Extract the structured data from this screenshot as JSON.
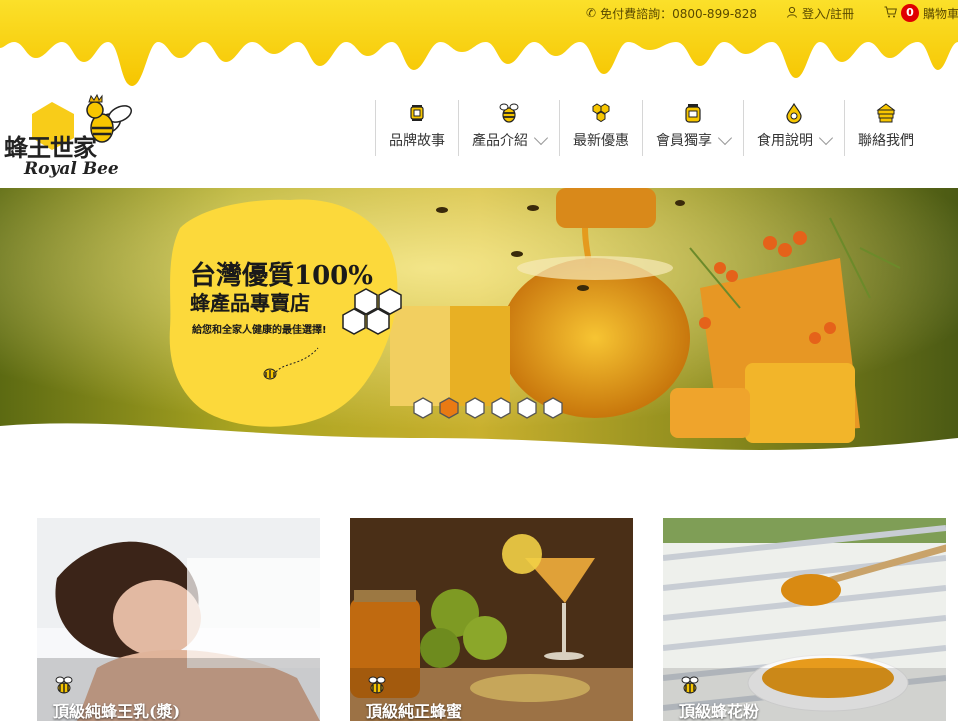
{
  "header": {
    "hotline": "免付費諮詢：0800-899-828",
    "login": "登入/註冊",
    "cart_count": "0",
    "cart_label": "購物車"
  },
  "logo": {
    "cn": "蜂王世家",
    "en": "Royal Bee"
  },
  "nav": [
    {
      "label": "品牌故事",
      "icon": "lantern-icon",
      "dropdown": false
    },
    {
      "label": "產品介紹",
      "icon": "bee-icon",
      "dropdown": true
    },
    {
      "label": "最新優惠",
      "icon": "honeycomb-icon",
      "dropdown": false
    },
    {
      "label": "會員獨享",
      "icon": "honey-jar-icon",
      "dropdown": true
    },
    {
      "label": "食用說明",
      "icon": "honey-drop-icon",
      "dropdown": true
    },
    {
      "label": "聯絡我們",
      "icon": "beehive-icon",
      "dropdown": false
    }
  ],
  "banner": {
    "title1": "台灣優質100%",
    "title2": "蜂產品專賣店",
    "subtitle": "給您和全家人健康的最佳選擇!",
    "slides": 6,
    "active_slide": 2
  },
  "products": [
    {
      "title": "頂級純蜂王乳(漿)"
    },
    {
      "title": "頂級純正蜂蜜"
    },
    {
      "title": "頂級蜂花粉"
    }
  ],
  "colors": {
    "honey": "#f8d10a",
    "honey_dark": "#f0b400",
    "cart_badge": "#e00000"
  }
}
